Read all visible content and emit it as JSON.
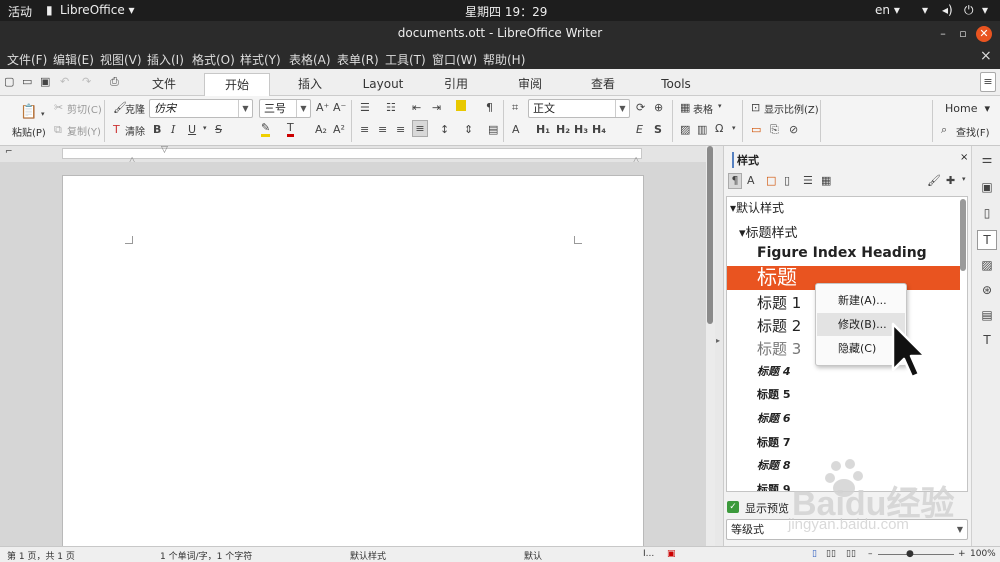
{
  "gnome": {
    "activities": "活动",
    "app_name": "LibreOffice",
    "clock": "星期四 19：29",
    "lang": "en"
  },
  "window": {
    "title": "documents.ott - LibreOffice Writer"
  },
  "menu": [
    "文件(F)",
    "编辑(E)",
    "视图(V)",
    "插入(I)",
    "格式(O)",
    "样式(Y)",
    "表格(A)",
    "表单(R)",
    "工具(T)",
    "窗口(W)",
    "帮助(H)"
  ],
  "tabs": [
    "文件",
    "开始",
    "插入",
    "Layout",
    "引用",
    "审阅",
    "查看",
    "Tools"
  ],
  "active_tab": "开始",
  "ribbon": {
    "cut": "剪切(C)",
    "copy": "复制(Y)",
    "paste": "粘贴(P)",
    "clone": "克隆",
    "clear": "清除",
    "font_name": "仿宋",
    "font_size": "三号",
    "para_style": "正文",
    "table": "表格",
    "zoom": "显示比例(Z)",
    "home": "Home",
    "find": "查找(F)"
  },
  "sidebar": {
    "title": "样式",
    "items": [
      {
        "label": "默认样式"
      },
      {
        "label": "标题样式"
      },
      {
        "label": "Figure Index Heading"
      },
      {
        "label": "标题"
      },
      {
        "label": "标题 1"
      },
      {
        "label": "标题 2"
      },
      {
        "label": "标题 3"
      },
      {
        "label": "标题 4"
      },
      {
        "label": "标题 5"
      },
      {
        "label": "标题 6"
      },
      {
        "label": "标题 7"
      },
      {
        "label": "标题 8"
      },
      {
        "label": "标题 9"
      }
    ],
    "show_preview": "显示预览",
    "filter": "等级式"
  },
  "context_menu": {
    "new": "新建(A)...",
    "modify": "修改(B)...",
    "hide": "隐藏(C)"
  },
  "status": {
    "page": "第 1 页，共 1 页",
    "words": "1 个单词/字，1 个字符",
    "page_style": "默认样式",
    "language": "默认",
    "zoom": "100%"
  },
  "watermark": {
    "brand": "Baidu经验",
    "url": "jingyan.baidu.com"
  },
  "colors": {
    "accent": "#e95420",
    "dark_bar": "#1d1d1d",
    "title_bar": "#2b2b2b"
  }
}
